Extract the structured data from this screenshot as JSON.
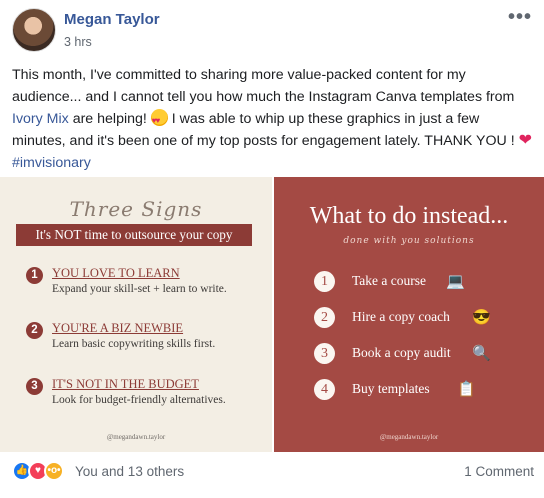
{
  "post": {
    "author": "Megan Taylor",
    "timestamp": "3 hrs",
    "more_label": "•••",
    "text_part1": "This month, I've committed to sharing more value-packed content for my audience... and I cannot tell you how much the Instagram Canva templates from ",
    "link_text": "Ivory Mix",
    "text_part2": " are helping! ",
    "text_part3": " I was able to whip up these graphics in just a few minutes, and it's been one of my top posts for engagement lately. THANK YOU ! ",
    "heart": "❤",
    "hashtag": "#imvisionary"
  },
  "image_left": {
    "script_title": "Three Signs",
    "banner": "It's NOT time to outsource your copy",
    "signs": [
      {
        "num": "1",
        "title": "YOU LOVE TO LEARN",
        "desc": "Expand your skill-set + learn to write."
      },
      {
        "num": "2",
        "title": "YOU'RE A BIZ NEWBIE",
        "desc": "Learn basic copywriting skills first."
      },
      {
        "num": "3",
        "title": "IT'S NOT IN THE BUDGET",
        "desc": "Look for budget-friendly alternatives."
      }
    ],
    "handle": "@megandawn.taylor"
  },
  "image_right": {
    "title": "What to do instead...",
    "subtitle": "done with you solutions",
    "steps": [
      {
        "num": "1",
        "label": "Take a course",
        "icon": "💻"
      },
      {
        "num": "2",
        "label": "Hire a copy coach",
        "icon": "😎"
      },
      {
        "num": "3",
        "label": "Book a copy audit",
        "icon": "🔍"
      },
      {
        "num": "4",
        "label": "Buy templates",
        "icon": "📋"
      }
    ],
    "handle": "@megandawn.taylor"
  },
  "footer": {
    "reactions": [
      "like-icon",
      "love-icon",
      "wow-icon"
    ],
    "reactors": "You and 13 others",
    "comments": "1 Comment"
  },
  "colors": {
    "link": "#385898",
    "brand_red": "#8c3b36",
    "panel_red": "#a44a44",
    "cream": "#f3eee4"
  }
}
